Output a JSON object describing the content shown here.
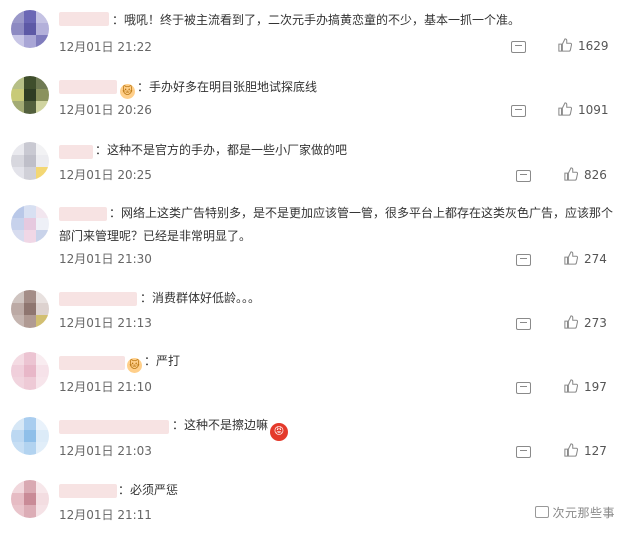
{
  "comments": [
    {
      "text": "：哦吼！终于被主流看到了，二次元手办搞黄恋童的不少，基本一抓一个准。",
      "time": "12月01日 21:22",
      "likes": "1629",
      "avatar_colors": [
        "#9a98c9",
        "#6b67b5",
        "#c4c2e3",
        "#8d8ac2",
        "#5d59a6",
        "#b3b0da",
        "#c8c6e6",
        "#a9a6d6",
        "#7f7cbd"
      ]
    },
    {
      "text": "手办好多在明目张胆地试探底线",
      "time": "12月01日 20:26",
      "likes": "1091",
      "has_emoji_before": true,
      "avatar_colors": [
        "#b6bf86",
        "#3f4e2c",
        "#6f7a53",
        "#c8ca78",
        "#2f3d24",
        "#8a925d",
        "#a3ab74",
        "#53603d",
        "#d0d4a0"
      ]
    },
    {
      "text": "：这种不是官方的手办，都是一些小厂家做的吧",
      "time": "12月01日 20:25",
      "likes": "826",
      "avatar_colors": [
        "#e9e9ee",
        "#c9c9d2",
        "#f2f2f4",
        "#d7d7de",
        "#bfbfc9",
        "#ececf0",
        "#e3e3ea",
        "#d0d0d8",
        "#f3d774"
      ]
    },
    {
      "text": "：网络上这类广告特别多，是不是更加应该管一管，很多平台上都存在这类灰色广告，应该那个部门来管理呢？已经是非常明显了。",
      "time": "12月01日 21:30",
      "likes": "274",
      "avatar_colors": [
        "#b9c8e8",
        "#d8e0f2",
        "#f2e6ef",
        "#c7d2ec",
        "#e6c9df",
        "#eef0f7",
        "#d7dcef",
        "#f0d7e6",
        "#c9d3ea"
      ]
    },
    {
      "text": "：消费群体好低龄。。。",
      "time": "12月01日 21:13",
      "likes": "273",
      "avatar_colors": [
        "#cfc4c0",
        "#a48d87",
        "#e8e1df",
        "#bcaaa5",
        "#8f7670",
        "#ddd2cf",
        "#c5b5b0",
        "#b09a93",
        "#d2bf72"
      ]
    },
    {
      "text": "：严打",
      "time": "12月01日 21:10",
      "likes": "197",
      "has_emoji_before": true,
      "avatar_colors": [
        "#f4dbe3",
        "#ecc4d2",
        "#f9ecf0",
        "#f0cfdb",
        "#e8b7c8",
        "#f6e2e9",
        "#f1d4de",
        "#eecad6",
        "#f7e5eb"
      ]
    },
    {
      "text": "：这种不是擦边嘛",
      "time": "12月01日 21:03",
      "likes": "127",
      "has_emoji_after": true,
      "avatar_colors": [
        "#d6e7f6",
        "#a9cdef",
        "#e9f2fb",
        "#bcd8f2",
        "#8fbfe9",
        "#dcebf8",
        "#c6def4",
        "#b2d3f0",
        "#e1eef9"
      ]
    },
    {
      "text": "：必须严惩",
      "time": "12月01日 21:11",
      "likes": "",
      "avatar_colors": [
        "#f1d7dc",
        "#d9a9b2",
        "#f7e7ea",
        "#e6bcc4",
        "#c98b97",
        "#f3dde1",
        "#e9c4cb",
        "#dcadb6",
        "#f5e2e6"
      ]
    }
  ],
  "emoji_cat_glyph": "🐱",
  "emoji_angry_glyph": "😡",
  "watermark": "次元那些事",
  "icons": {
    "reply": "comment-icon",
    "like": "thumbs-up-icon"
  },
  "colors": {
    "text": "#333333",
    "meta": "#666666",
    "icon": "#8a8a8a",
    "name_blur": "#f6dede"
  }
}
